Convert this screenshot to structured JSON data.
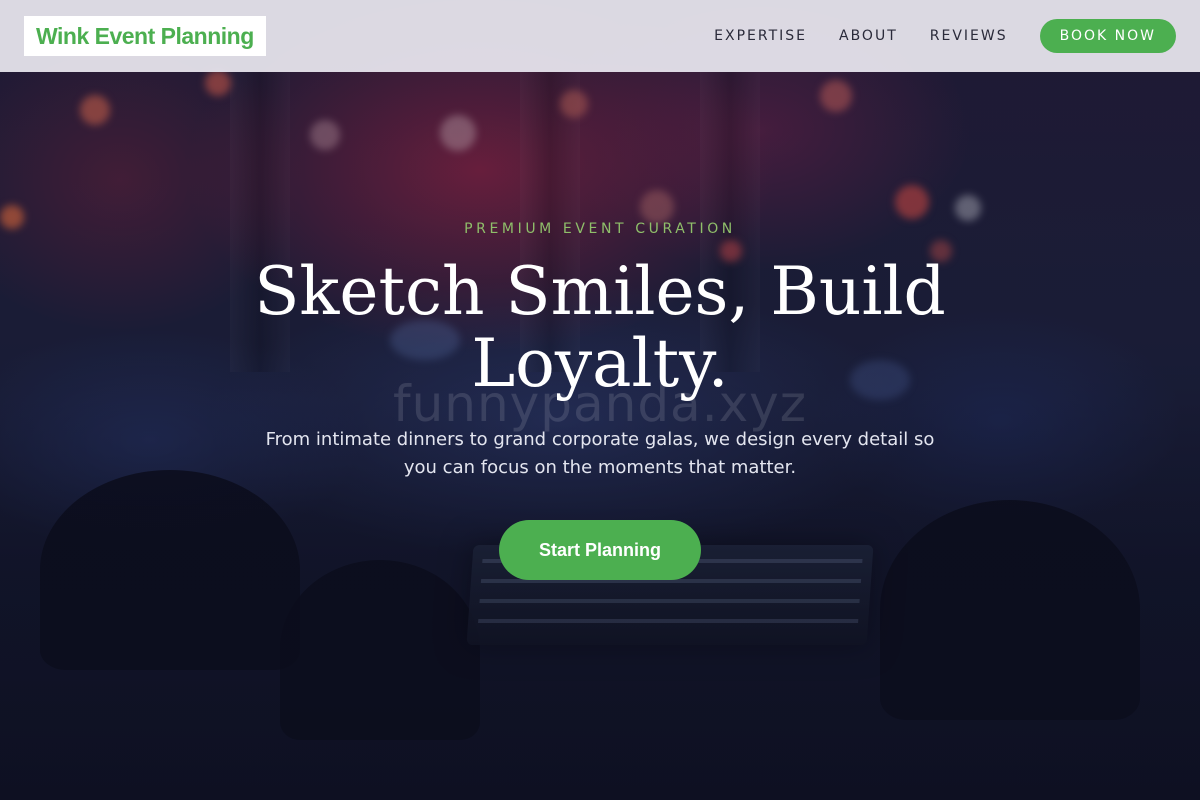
{
  "header": {
    "logo": "Wink Event Planning",
    "nav": [
      {
        "label": "EXPERTISE"
      },
      {
        "label": "ABOUT"
      },
      {
        "label": "REVIEWS"
      }
    ],
    "cta_label": "BOOK NOW"
  },
  "hero": {
    "eyebrow": "PREMIUM EVENT CURATION",
    "headline": "Sketch Smiles, Build Loyalty.",
    "subtext": "From intimate dinners to grand corporate galas, we design every detail so you can focus on the moments that matter.",
    "cta_label": "Start Planning",
    "watermark": "funnypanda.xyz"
  },
  "colors": {
    "accent": "#4caf50",
    "eyebrow": "#8fbf6a",
    "header_bg": "#e6e4ec",
    "hero_bg": "#15172a"
  }
}
